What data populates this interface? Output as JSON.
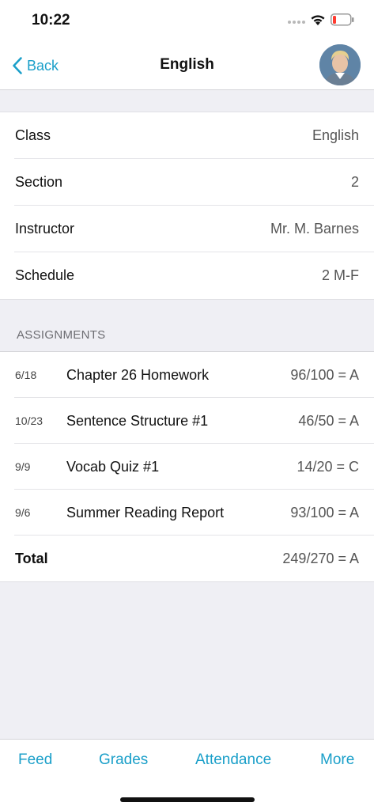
{
  "status_bar": {
    "time": "10:22",
    "icons": [
      "signal-dots-icon",
      "wifi-icon",
      "battery-low-icon"
    ],
    "battery_color": "#ff3b30"
  },
  "nav": {
    "back_label": "Back",
    "title": "English",
    "accent_color": "#1a9fc9"
  },
  "class_info": [
    {
      "label": "Class",
      "value": "English"
    },
    {
      "label": "Section",
      "value": "2"
    },
    {
      "label": "Instructor",
      "value": "Mr. M. Barnes"
    },
    {
      "label": "Schedule",
      "value": "2 M-F"
    }
  ],
  "assignments": {
    "header": "ASSIGNMENTS",
    "items": [
      {
        "date": "6/18",
        "name": "Chapter 26 Homework",
        "score": "96/100 = A"
      },
      {
        "date": "10/23",
        "name": "Sentence Structure #1",
        "score": "46/50 = A"
      },
      {
        "date": "9/9",
        "name": "Vocab Quiz #1",
        "score": "14/20 = C"
      },
      {
        "date": "9/6",
        "name": "Summer Reading Report",
        "score": "93/100 = A"
      }
    ],
    "total_label": "Total",
    "total_score": "249/270 = A"
  },
  "tabs": [
    {
      "label": "Feed"
    },
    {
      "label": "Grades"
    },
    {
      "label": "Attendance"
    },
    {
      "label": "More"
    }
  ]
}
